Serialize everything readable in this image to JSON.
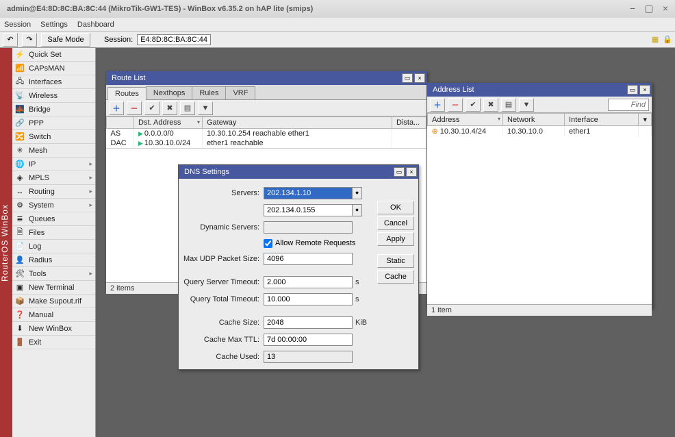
{
  "title": "admin@E4:8D:8C:BA:8C:44 (MikroTik-GW1-TES) - WinBox v6.35.2 on hAP lite (smips)",
  "menubar": [
    "Session",
    "Settings",
    "Dashboard"
  ],
  "toolbar": {
    "safe_mode": "Safe Mode",
    "session_label": "Session:",
    "session_value": "E4:8D:8C:BA:8C:44"
  },
  "sidebar_rail": "RouterOS  WinBox",
  "menu": [
    {
      "icon": "⚡",
      "label": "Quick Set"
    },
    {
      "icon": "📶",
      "label": "CAPsMAN"
    },
    {
      "icon": "🖧",
      "label": "Interfaces"
    },
    {
      "icon": "📡",
      "label": "Wireless"
    },
    {
      "icon": "🌉",
      "label": "Bridge"
    },
    {
      "icon": "🔗",
      "label": "PPP"
    },
    {
      "icon": "🔀",
      "label": "Switch"
    },
    {
      "icon": "✳",
      "label": "Mesh"
    },
    {
      "icon": "🌐",
      "label": "IP",
      "sub": true
    },
    {
      "icon": "◈",
      "label": "MPLS",
      "sub": true
    },
    {
      "icon": "↔",
      "label": "Routing",
      "sub": true
    },
    {
      "icon": "⚙",
      "label": "System",
      "sub": true
    },
    {
      "icon": "≣",
      "label": "Queues"
    },
    {
      "icon": "🗎",
      "label": "Files"
    },
    {
      "icon": "📄",
      "label": "Log"
    },
    {
      "icon": "👤",
      "label": "Radius"
    },
    {
      "icon": "🛠",
      "label": "Tools",
      "sub": true
    },
    {
      "icon": "▣",
      "label": "New Terminal"
    },
    {
      "icon": "📦",
      "label": "Make Supout.rif"
    },
    {
      "icon": "❓",
      "label": "Manual"
    },
    {
      "icon": "⬇",
      "label": "New WinBox"
    },
    {
      "icon": "🚪",
      "label": "Exit"
    }
  ],
  "route_list": {
    "title": "Route List",
    "tabs": [
      "Routes",
      "Nexthops",
      "Rules",
      "VRF"
    ],
    "active_tab": 0,
    "cols": [
      "",
      "Dst. Address",
      "Gateway",
      "Dista..."
    ],
    "rows": [
      {
        "flags": "AS",
        "dst": "0.0.0.0/0",
        "gw": "10.30.10.254 reachable ether1"
      },
      {
        "flags": "DAC",
        "dst": "10.30.10.0/24",
        "gw": "ether1 reachable"
      }
    ],
    "status": "2 items"
  },
  "address_list": {
    "title": "Address List",
    "find_placeholder": "Find",
    "cols": [
      "Address",
      "Network",
      "Interface"
    ],
    "rows": [
      {
        "addr": "10.30.10.4/24",
        "net": "10.30.10.0",
        "iface": "ether1"
      }
    ],
    "status": "1 item"
  },
  "dns": {
    "title": "DNS Settings",
    "labels": {
      "servers": "Servers:",
      "dynamic": "Dynamic Servers:",
      "allow": "Allow Remote Requests",
      "maxudp": "Max UDP Packet Size:",
      "qst": "Query Server Timeout:",
      "qtt": "Query Total Timeout:",
      "csize": "Cache Size:",
      "cttl": "Cache Max TTL:",
      "cused": "Cache Used:"
    },
    "values": {
      "server1": "202.134.1.10",
      "server2": "202.134.0.155",
      "allow": true,
      "maxudp": "4096",
      "qst": "2.000",
      "qtt": "10.000",
      "csize": "2048",
      "cttl": "7d 00:00:00",
      "cused": "13",
      "unit_s": "s",
      "unit_kib": "KiB"
    },
    "buttons": {
      "ok": "OK",
      "cancel": "Cancel",
      "apply": "Apply",
      "static": "Static",
      "cache": "Cache"
    }
  }
}
